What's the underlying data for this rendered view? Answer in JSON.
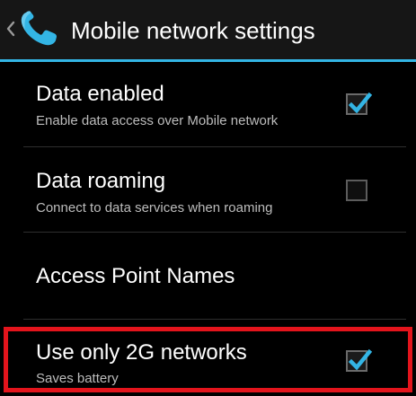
{
  "colors": {
    "accent": "#33b5e5",
    "highlight": "#e3141c",
    "background": "#000000",
    "summary_text": "#bdbdbd"
  },
  "action_bar": {
    "title": "Mobile network settings",
    "up_icon": "chevron-left-icon",
    "app_icon": "phone-icon"
  },
  "preferences": [
    {
      "title": "Data enabled",
      "summary": "Enable data access over Mobile network",
      "checked": true
    },
    {
      "title": "Data roaming",
      "summary": "Connect to data services when roaming",
      "checked": false
    },
    {
      "title": "Access Point Names"
    },
    {
      "title": "Use only 2G networks",
      "summary": "Saves battery",
      "checked": true
    }
  ]
}
